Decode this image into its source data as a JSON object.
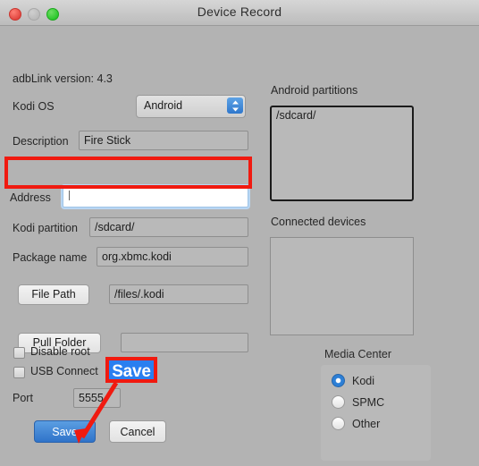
{
  "window": {
    "title": "Device Record",
    "controls": [
      "close",
      "minimize",
      "zoom"
    ]
  },
  "left_panel": {
    "version_label": "adbLink version: 4.3",
    "os_label": "Kodi OS",
    "os_value": "Android",
    "description_label": "Description",
    "description_value": "Fire Stick",
    "address_label": "Address",
    "address_value": "",
    "address_placeholder": "",
    "kodi_partition_label": "Kodi partition",
    "kodi_partition_value": "/sdcard/",
    "package_name_label": "Package name",
    "package_name_value": "org.xbmc.kodi",
    "file_path_button": "File Path",
    "file_path_value": "/files/.kodi",
    "pull_folder_button": "Pull Folder",
    "pull_folder_value": "",
    "disable_root_label": "Disable root",
    "disable_root_checked": false,
    "usb_connect_label": "USB Connect",
    "usb_connect_checked": false,
    "port_label": "Port",
    "port_value": "5555",
    "save_button": "Save",
    "cancel_button": "Cancel"
  },
  "right_panel": {
    "android_partitions_label": "Android partitions",
    "android_partitions_items": [
      "/sdcard/"
    ],
    "connected_devices_label": "Connected devices",
    "connected_devices_items": [],
    "media_center_label": "Media Center",
    "media_center_options": [
      "Kodi",
      "SPMC",
      "Other"
    ],
    "media_center_selected": "Kodi"
  },
  "annotations": {
    "highlight_field": "Address",
    "callout_label": "Save",
    "callout_color": "#f01a10",
    "callout_fill": "#2a7ff0"
  }
}
